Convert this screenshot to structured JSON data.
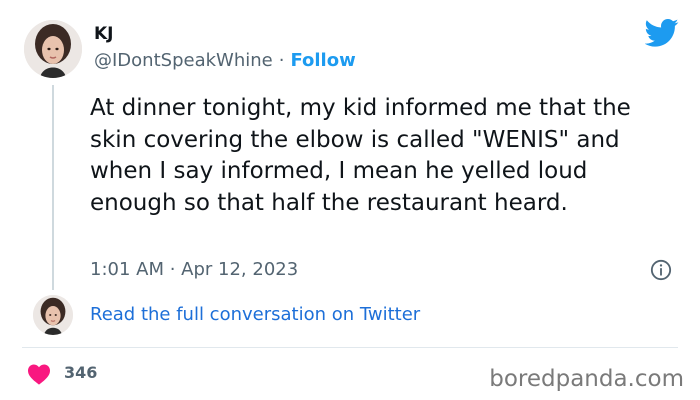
{
  "tweet": {
    "display_name": "KJ",
    "handle": "@IDontSpeakWhine",
    "separator": "·",
    "follow_label": "Follow",
    "text": "At dinner tonight, my kid informed me that the skin covering the elbow is called \"WENIS\" and when I say informed, I mean he yelled loud enough so that half the restaurant heard.",
    "timestamp": "1:01 AM · Apr 12, 2023",
    "read_conversation_label": "Read the full conversation on Twitter",
    "like_count": "346"
  },
  "watermark": "boredpanda.com",
  "icons": {
    "logo": "twitter-bird-icon",
    "info": "info-icon",
    "like": "heart-icon"
  },
  "colors": {
    "twitter_blue": "#1d9bf0",
    "link_blue": "#1d6fd8",
    "heart_red": "#f91880",
    "muted_text": "#536471"
  }
}
